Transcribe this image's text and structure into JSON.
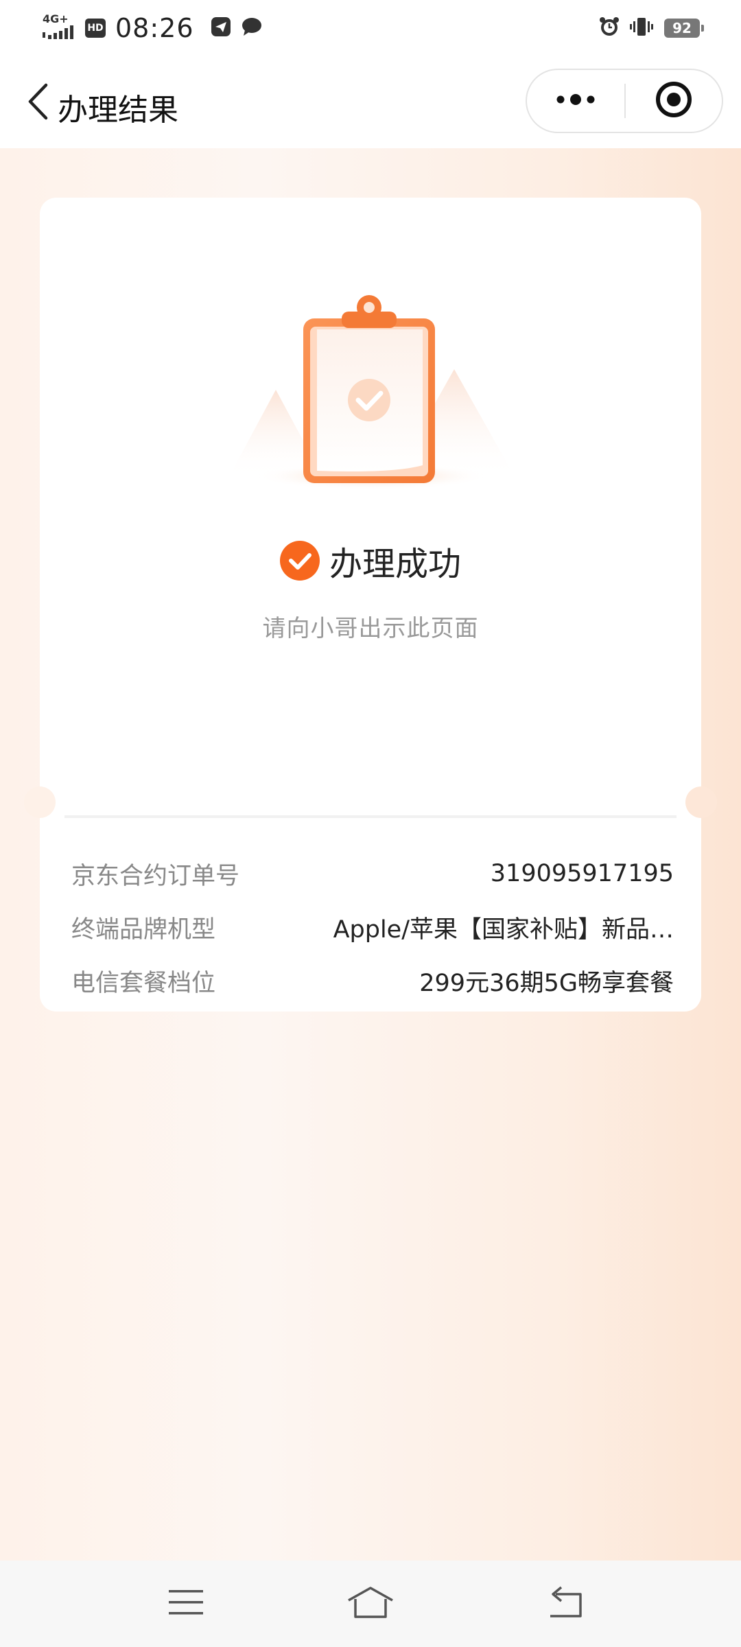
{
  "status_bar": {
    "network": "4G+",
    "hd": "HD",
    "time": "08:26",
    "battery": "92",
    "icons": [
      "signal-icon",
      "telegram-icon",
      "chat-bubble-icon",
      "alarm-icon",
      "vibrate-icon",
      "battery-icon"
    ]
  },
  "nav": {
    "title": "办理结果",
    "back_icon": "chevron-left-icon",
    "more_icon": "more-dots-icon",
    "close_icon": "target-circle-icon"
  },
  "result": {
    "status_title": "办理成功",
    "subtitle": "请向小哥出示此页面",
    "status_icon": "check-circle-icon",
    "hero_icon": "clipboard-check-icon"
  },
  "details": [
    {
      "label": "京东合约订单号",
      "value": "319095917195"
    },
    {
      "label": "终端品牌机型",
      "value": "Apple/苹果【国家补贴】新品…"
    },
    {
      "label": "电信套餐档位",
      "value": "299元36期5G畅享套餐"
    }
  ],
  "system_nav": {
    "icons": [
      "menu-icon",
      "home-icon",
      "back-icon"
    ]
  },
  "colors": {
    "accent": "#f7671d",
    "page_bg_left": "#fef2ea",
    "page_bg_right": "#fce4d3",
    "card_bg": "#ffffff"
  }
}
